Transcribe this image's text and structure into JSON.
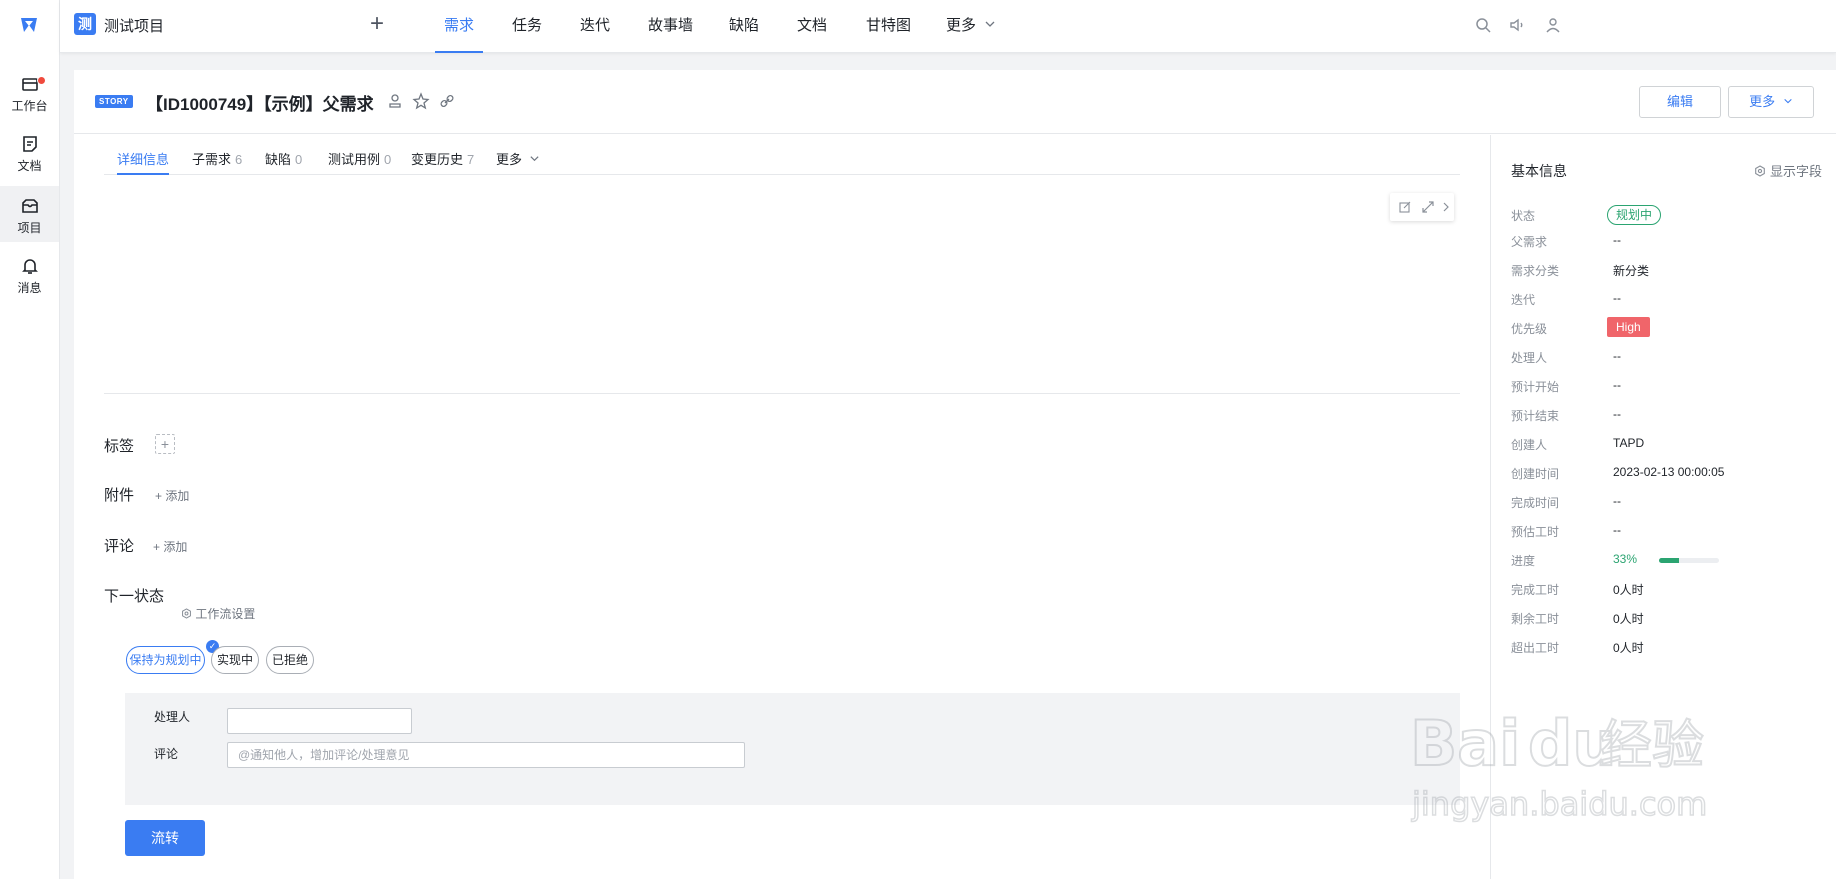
{
  "rail": {
    "items": [
      {
        "label": "工作台"
      },
      {
        "label": "文档"
      },
      {
        "label": "项目"
      },
      {
        "label": "消息"
      }
    ]
  },
  "topbar": {
    "project_badge": "测",
    "project_name": "测试项目",
    "tabs": [
      "需求",
      "任务",
      "迭代",
      "故事墙",
      "缺陷",
      "文档",
      "甘特图",
      "更多"
    ]
  },
  "header": {
    "type_badge": "STORY",
    "title": "【ID1000749】【示例】父需求",
    "edit_label": "编辑",
    "more_label": "更多"
  },
  "tabs": [
    {
      "label": "详细信息",
      "count": ""
    },
    {
      "label": "子需求",
      "count": "6"
    },
    {
      "label": "缺陷",
      "count": "0"
    },
    {
      "label": "测试用例",
      "count": "0"
    },
    {
      "label": "变更历史",
      "count": "7"
    },
    {
      "label": "更多",
      "count": ""
    }
  ],
  "sections": {
    "tags_label": "标签",
    "tag_add": "+",
    "attach_label": "附件",
    "attach_add": "添加",
    "comment_label": "评论",
    "comment_add": "添加",
    "next_state_label": "下一状态",
    "workflow_settings": "工作流设置"
  },
  "next_states": [
    "保持为规划中",
    "实现中",
    "已拒绝"
  ],
  "form": {
    "owner_label": "处理人",
    "owner_value": "",
    "comment_label": "评论",
    "comment_placeholder": "@通知他人，增加评论/处理意见",
    "submit_label": "流转"
  },
  "side": {
    "title": "基本信息",
    "show_fields": "显示字段",
    "fields": [
      {
        "k": "状态",
        "v": "规划中"
      },
      {
        "k": "父需求",
        "v": "--"
      },
      {
        "k": "需求分类",
        "v": "新分类"
      },
      {
        "k": "迭代",
        "v": "--"
      },
      {
        "k": "优先级",
        "v": "High"
      },
      {
        "k": "处理人",
        "v": "--"
      },
      {
        "k": "预计开始",
        "v": "--"
      },
      {
        "k": "预计结束",
        "v": "--"
      },
      {
        "k": "创建人",
        "v": "TAPD"
      },
      {
        "k": "创建时间",
        "v": "2023-02-13 00:00:05"
      },
      {
        "k": "完成时间",
        "v": "--"
      },
      {
        "k": "预估工时",
        "v": "--"
      },
      {
        "k": "进度",
        "v": "33%"
      },
      {
        "k": "完成工时",
        "v": "0人时"
      },
      {
        "k": "剩余工时",
        "v": "0人时"
      },
      {
        "k": "超出工时",
        "v": "0人时"
      }
    ],
    "progress_fraction": 0.33
  },
  "watermark": {
    "logo_text": "Bai",
    "logo_text2": "du",
    "logo_cn": "经验",
    "url": "jingyan.baidu.com"
  },
  "colors": {
    "accent": "#3a7cf2",
    "success": "#2ba471",
    "priority_high": "#f0656a",
    "notification": "#f04a3d"
  }
}
